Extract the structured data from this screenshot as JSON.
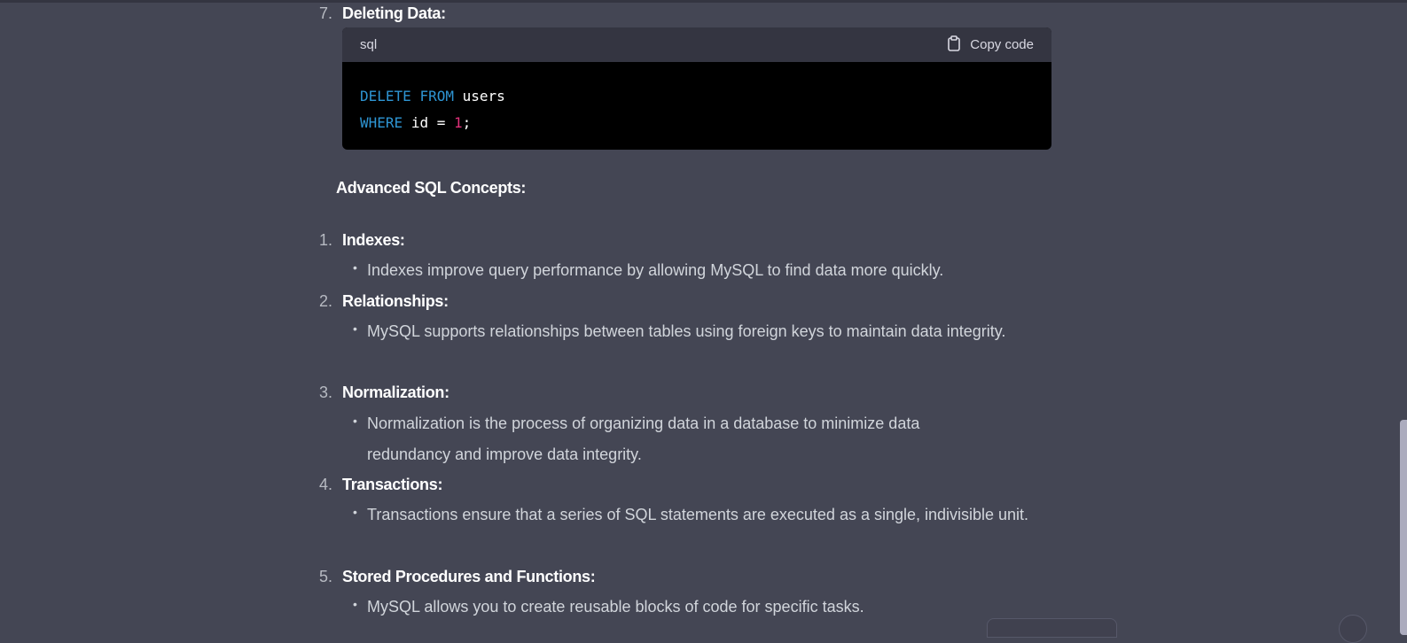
{
  "previous_item": {
    "number": "7.",
    "label": "Deleting Data:"
  },
  "code_block": {
    "language": "sql",
    "copy_label": "Copy code",
    "lines": [
      {
        "kw1": "DELETE",
        "kw2": "FROM",
        "rest": "users"
      },
      {
        "kw1": "WHERE",
        "ident": "id",
        "op": "=",
        "num": "1",
        "end": ";"
      }
    ]
  },
  "section_title": "Advanced SQL Concepts:",
  "items": [
    {
      "number": "1.",
      "label": "Indexes:",
      "bullets": [
        "Indexes improve query performance by allowing MySQL to find data more quickly."
      ]
    },
    {
      "number": "2.",
      "label": "Relationships:",
      "bullets": [
        "MySQL supports relationships between tables using foreign keys to maintain data integrity."
      ]
    },
    {
      "number": "3.",
      "label": "Normalization:",
      "bullets": [
        "Normalization is the process of organizing data in a database to minimize data redundancy and improve data integrity."
      ]
    },
    {
      "number": "4.",
      "label": "Transactions:",
      "bullets": [
        "Transactions ensure that a series of SQL statements are executed as a single, indivisible unit."
      ]
    },
    {
      "number": "5.",
      "label": "Stored Procedures and Functions:",
      "bullets": [
        "MySQL allows you to create reusable blocks of code for specific tasks."
      ]
    }
  ],
  "icons": {
    "copy": "clipboard-icon",
    "bullet": "bullet-dot"
  },
  "colors": {
    "background": "#444654",
    "keyword": "#2e95d3",
    "number_literal": "#df3079",
    "heading": "#ffffff"
  }
}
